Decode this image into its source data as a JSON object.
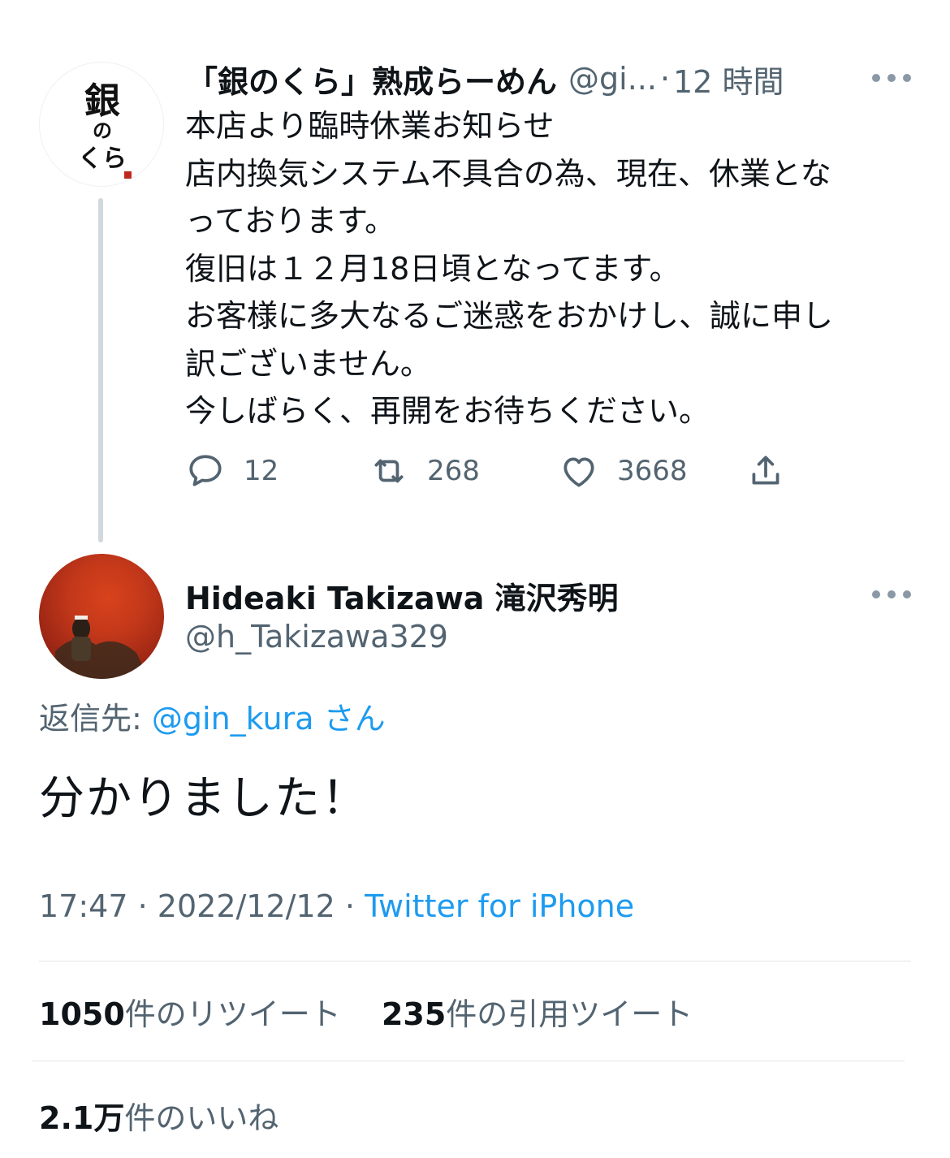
{
  "parent_tweet": {
    "display_name": "「銀のくら」熟成らーめん",
    "handle": "@gi...",
    "separator": "·",
    "time_ago": "12 時間",
    "avatar_text": [
      "銀",
      "の",
      "くら"
    ],
    "body_lines": [
      "本店より臨時休業お知らせ",
      "店内換気システム不具合の為、現在、休業とな",
      "っております。",
      "復旧は１２月18日頃となってます。",
      "お客様に多大なるご迷惑をおかけし、誠に申し",
      "訳ございません。",
      "今しばらく、再開をお待ちください。"
    ],
    "reply_count": "12",
    "retweet_count": "268",
    "like_count": "3668"
  },
  "focused_tweet": {
    "display_name": "Hideaki Takizawa 滝沢秀明",
    "handle": "@h_Takizawa329",
    "reply_prefix": "返信先:",
    "reply_handle": "@gin_kura",
    "reply_suffix": "さん",
    "text": "分かりました！",
    "time": "17:47",
    "date": "2022/12/12",
    "meta_separator": "·",
    "client": "Twitter for iPhone",
    "retweets_value": "1050",
    "retweets_label": "件のリツイート",
    "quotes_value": "235",
    "quotes_label": "件の引用ツイート",
    "likes_value": "2.1万",
    "likes_label": "件のいいね"
  },
  "icons": {
    "reply": "speech-bubble-icon",
    "retweet": "retweet-arrows-icon",
    "like": "heart-icon",
    "share": "share-upload-icon",
    "more": "more-dots-icon"
  },
  "colors": {
    "link": "#1d9bf0",
    "secondary_text": "#536471",
    "primary_text": "#0f1419",
    "thread_line": "#cfd9de"
  }
}
